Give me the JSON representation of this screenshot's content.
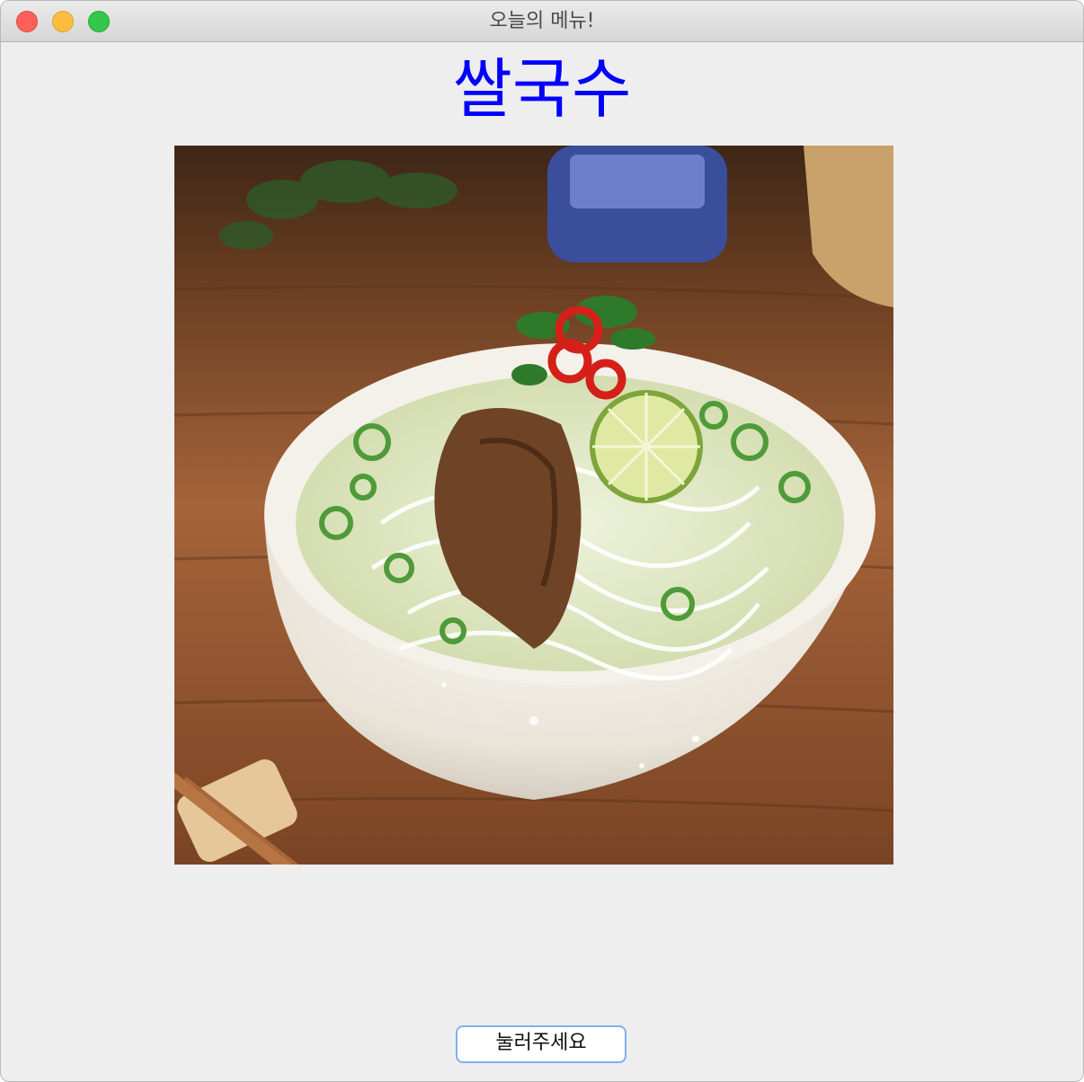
{
  "window": {
    "title": "오늘의 메뉴!"
  },
  "menu": {
    "title": "쌀국수",
    "title_color": "#0000ff"
  },
  "image": {
    "subject": "rice noodle soup bowl"
  },
  "button": {
    "label": "눌러주세요"
  },
  "colors": {
    "window_bg": "#eeeeee",
    "button_border": "#7fb0f0"
  }
}
